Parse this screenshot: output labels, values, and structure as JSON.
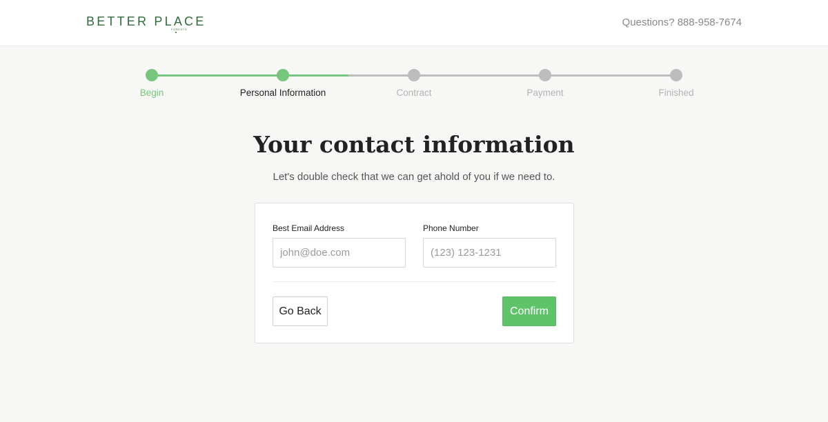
{
  "header": {
    "logo_text": "BETTER PLACE",
    "logo_sub": "FORESTS",
    "help_text": "Questions? 888-958-7674"
  },
  "stepper": {
    "steps": [
      {
        "label": "Begin",
        "state": "done"
      },
      {
        "label": "Personal Information",
        "state": "active"
      },
      {
        "label": "Contract",
        "state": "pending"
      },
      {
        "label": "Payment",
        "state": "pending"
      },
      {
        "label": "Finished",
        "state": "pending"
      }
    ],
    "colors": {
      "done": "#76c77b",
      "pending": "#bdbdbd"
    }
  },
  "main": {
    "title": "Your contact information",
    "subtitle": "Let's double check that we can get ahold of you if we need to."
  },
  "form": {
    "email_label": "Best Email Address",
    "email_placeholder": "john@doe.com",
    "email_value": "",
    "phone_label": "Phone Number",
    "phone_placeholder": "(123) 123-1231",
    "phone_value": "",
    "back_label": "Go Back",
    "confirm_label": "Confirm"
  },
  "colors": {
    "brand_green": "#2f6b3a",
    "accent_green": "#5fc36a",
    "background": "#f7f7f5"
  }
}
